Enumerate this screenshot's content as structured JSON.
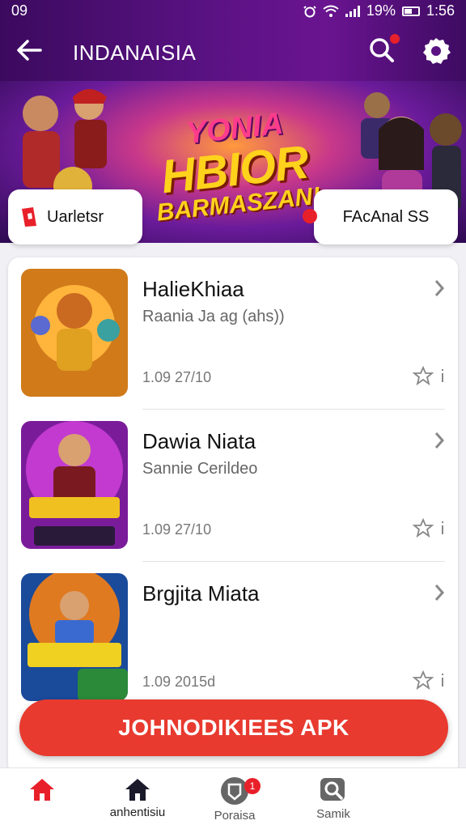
{
  "status_bar": {
    "time": "09",
    "battery": "19%",
    "clock": "1:56"
  },
  "app_bar": {
    "title": "INDANAISIA"
  },
  "banner": {
    "logo_line1": "YONIA",
    "logo_line2": "HBIOR",
    "logo_line3": "BARMASZAN!",
    "left_pill": "Uarletsr",
    "right_pill": "FAcAnal SS"
  },
  "list": [
    {
      "name": "HalieKhiaa",
      "subtitle": "Raania Ja ag (ahs))",
      "meta": "1.09 27/10"
    },
    {
      "name": "Dawia Niata",
      "subtitle": "Sannie Cerildeo",
      "meta": "1.09 27/10"
    },
    {
      "name": "Brgjita Miata",
      "subtitle": "",
      "meta": "1.09 2015d"
    }
  ],
  "cta": {
    "label": "JOHNODIKIEES APK"
  },
  "bottom_nav": [
    {
      "label": "",
      "icon": "home-icon"
    },
    {
      "label": "anhentisiu",
      "icon": "home-dark-icon"
    },
    {
      "label": "Poraisa",
      "icon": "shield-icon",
      "badge": "1"
    },
    {
      "label": "Samik",
      "icon": "search-icon"
    }
  ],
  "colors": {
    "accent": "#e83a2f",
    "appbar": "#5a1283"
  }
}
